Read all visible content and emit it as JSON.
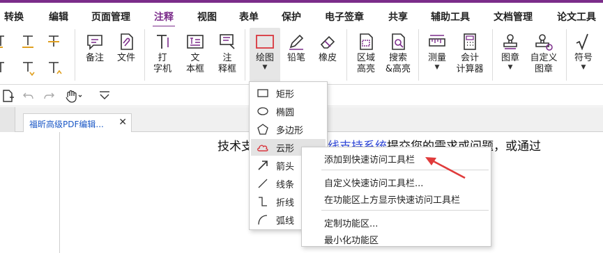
{
  "menubar": {
    "tabs": [
      "转换",
      "编辑",
      "页面管理",
      "注释",
      "视图",
      "表单",
      "保护",
      "电子签章",
      "共享",
      "辅助工具",
      "文档管理",
      "论文工具"
    ],
    "active_tab": "注释"
  },
  "ribbon": {
    "note": "备注",
    "file": "文件",
    "typewriter_line1": "打",
    "typewriter_line2": "字机",
    "textbox_line1": "文",
    "textbox_line2": "本框",
    "callout_line1": "注",
    "callout_line2": "释框",
    "drawing": "绘图",
    "pencil": "铅笔",
    "eraser": "橡皮",
    "area_hl_line1": "区域",
    "area_hl_line2": "高亮",
    "search_hl_line1": "搜索",
    "search_hl_line2": "&高亮",
    "measure": "测量",
    "calculator_line1": "会计",
    "calculator_line2": "计算器",
    "stamp": "图章",
    "custom_stamp_line1": "自定义",
    "custom_stamp_line2": "图章",
    "symbol": "符号"
  },
  "document": {
    "tab_title": "福昕高级PDF编辑...",
    "text_before": "技术支",
    "link_text": "线支持系统",
    "text_after": "提交您的需求或问题，或通过"
  },
  "drawing_menu": {
    "items": [
      "矩形",
      "椭圆",
      "多边形",
      "云形",
      "箭头",
      "线条",
      "折线",
      "弧线"
    ],
    "hovered": "云形"
  },
  "context_menu": {
    "items": [
      "添加到快速访问工具栏",
      "自定义快速访问工具栏...",
      "在功能区上方显示快速访问工具栏",
      "定制功能区...",
      "最小化功能区"
    ]
  },
  "colors": {
    "accent": "#7b2c8a",
    "link": "#2f47d8",
    "arrow": "#e03b3b",
    "cloud_icon": "#d9363e"
  }
}
